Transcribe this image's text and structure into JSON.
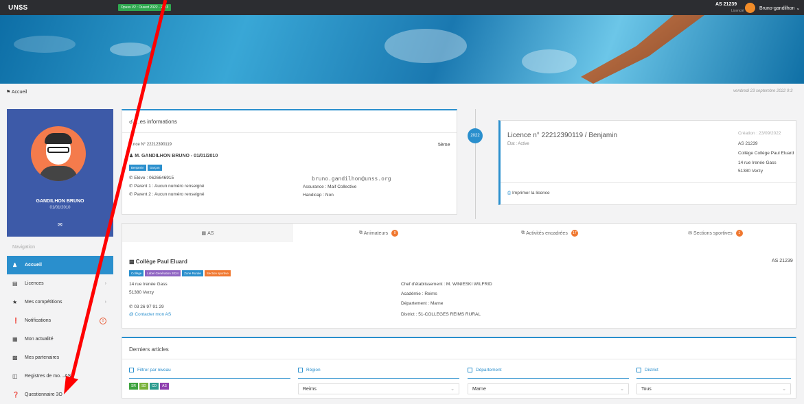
{
  "topbar": {
    "logo": "UN$S",
    "open_badge": "Opuss V2 : Ouvert 2022 - 2023",
    "as_id": "AS 21239",
    "role": "Licencié",
    "user": "Bruno-gandilhon"
  },
  "breadcrumb": {
    "home": "Accueil"
  },
  "date": "vendredi 23 septembre 2022 9:3",
  "profile": {
    "name": "GANDILHON BRUNO",
    "dob": "01/01/2010"
  },
  "nav": {
    "label": "Navigation",
    "items": [
      {
        "label": "Accueil",
        "icon": "user-icon"
      },
      {
        "label": "Licences",
        "icon": "list-icon"
      },
      {
        "label": "Mes compétitions",
        "icon": "trophy-icon"
      },
      {
        "label": "Notifications",
        "icon": "alert-icon",
        "badge": "0"
      },
      {
        "label": "Mon actualité",
        "icon": "news-icon"
      },
      {
        "label": "Mes partenaires",
        "icon": "partners-icon"
      },
      {
        "label": "Registres de mo…AS",
        "icon": "book-icon"
      },
      {
        "label": "Questionnaire 3O",
        "icon": "help-icon"
      }
    ]
  },
  "info": {
    "title": "…es informations",
    "licence": "…nce N° 22212390119",
    "level": "5ème",
    "name": "M. GANDILHON BRUNO - 01/01/2010",
    "tags": [
      "Benjamin",
      "Garçon"
    ],
    "phone_eleve": "Elève : 0626646915",
    "phone_p1": "Parent 1 : Aucun numéro renseigné",
    "phone_p2": "Parent 2 : Aucun numéro renseigné",
    "email": "bruno.gandilhon@unss.org",
    "assurance": "Assurance : Maif Collective",
    "handicap": "Handicap : Non"
  },
  "timeline": {
    "year": "2022"
  },
  "licence": {
    "title": "Licence n° 22212390119 / Benjamin",
    "state": "État : Active",
    "creation": "Création : 23/09/2022",
    "as_id": "AS 21239",
    "college": "Collège Collège Paul Eluard",
    "street": "14 rue Irenée Gass",
    "city": "51380 Verzy",
    "print": "Imprimer la licence"
  },
  "tabs": [
    {
      "label": "AS",
      "count": ""
    },
    {
      "label": "Animateurs",
      "count": "0"
    },
    {
      "label": "Activités encadrées",
      "count": "17"
    },
    {
      "label": "Sections sportives",
      "count": "1"
    }
  ],
  "as": {
    "title": "Collège Paul Eluard",
    "tags": [
      "Collège",
      "Label Génération 2024",
      "Zone Rurale",
      "Section sportive"
    ],
    "as_id": "AS 21239",
    "street": "14 rue Irenée Gass",
    "city": "51380 Verzy",
    "phone": "03 26 97 91 29",
    "contact": "Contacter mon AS",
    "chef": "Chef d'établissement : M. WINIESKI WILFRID",
    "academie": "Académie : Reims",
    "departement": "Département : Marne",
    "district": "District : 51-COLLEGES REIMS RURAL"
  },
  "articles": {
    "title": "Derniers articles",
    "filters": [
      {
        "label": "Filtrer par niveau",
        "value": ""
      },
      {
        "label": "Région",
        "value": "Reims"
      },
      {
        "label": "Département",
        "value": "Marne"
      },
      {
        "label": "District",
        "value": "Tous"
      }
    ],
    "levels": [
      "SR",
      "SD",
      "CD",
      "AS"
    ]
  },
  "colors": {
    "primary": "#2a8fcd",
    "nav_bg": "#3d5aa8",
    "badge": "#f07830",
    "arrow": "#ff0000"
  }
}
